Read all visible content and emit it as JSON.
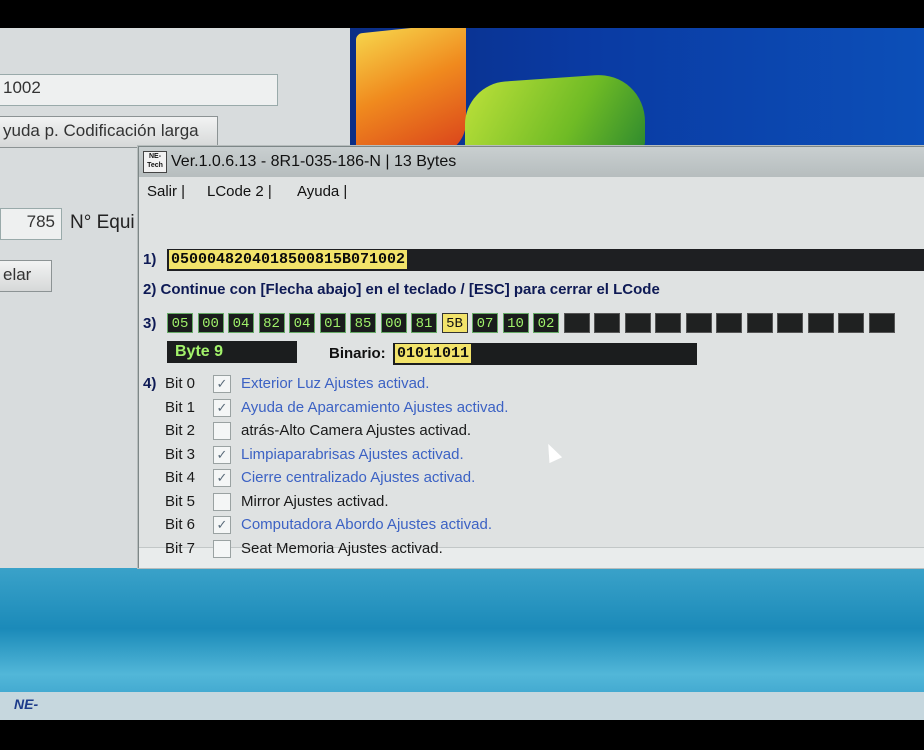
{
  "parent_window": {
    "field_top": "1002",
    "help_button": "yuda p. Codificación larga",
    "number_field": "785",
    "equip_label": "N° Equi",
    "cancel_button": "elar"
  },
  "dialog": {
    "icon_text": "NE-Tech",
    "title": "Ver.1.0.6.13 -   8R1-035-186-N | 13 Bytes",
    "menu": [
      "Salir |",
      "LCode 2 |",
      "Ayuda |"
    ],
    "step1_num": "1)",
    "code_value": "0500048204018500815B071002",
    "step2_text": "2) Continue con [Flecha abajo] en el teclado / [ESC] para cerrar el LCode",
    "step3_num": "3)",
    "bytes": [
      "05",
      "00",
      "04",
      "82",
      "04",
      "01",
      "85",
      "00",
      "81",
      "5B",
      "07",
      "10",
      "02"
    ],
    "selected_byte_index": 9,
    "empty_cells": 11,
    "byte_label": "Byte 9",
    "binary_label": "Binario:",
    "binary_value": "01011011",
    "step4_num": "4)",
    "bits": [
      {
        "label": "Bit 0",
        "checked": true,
        "text": "Exterior Luz Ajustes activad."
      },
      {
        "label": "Bit 1",
        "checked": true,
        "text": "Ayuda de Aparcamiento Ajustes activad."
      },
      {
        "label": "Bit 2",
        "checked": false,
        "text": "atrás-Alto Camera Ajustes activad."
      },
      {
        "label": "Bit 3",
        "checked": true,
        "text": "Limpiaparabrisas Ajustes activad."
      },
      {
        "label": "Bit 4",
        "checked": true,
        "text": "Cierre centralizado Ajustes activad."
      },
      {
        "label": "Bit 5",
        "checked": false,
        "text": "Mirror Ajustes activad."
      },
      {
        "label": "Bit 6",
        "checked": true,
        "text": "Computadora Abordo Ajustes activad."
      },
      {
        "label": "Bit 7",
        "checked": false,
        "text": "Seat Memoria Ajustes activad."
      }
    ]
  },
  "taskbar": {
    "logo_text": "NE-"
  },
  "colors": {
    "active_text": "#3c62c4",
    "byte_green": "#9ff06a",
    "highlight": "#f2e36a"
  }
}
